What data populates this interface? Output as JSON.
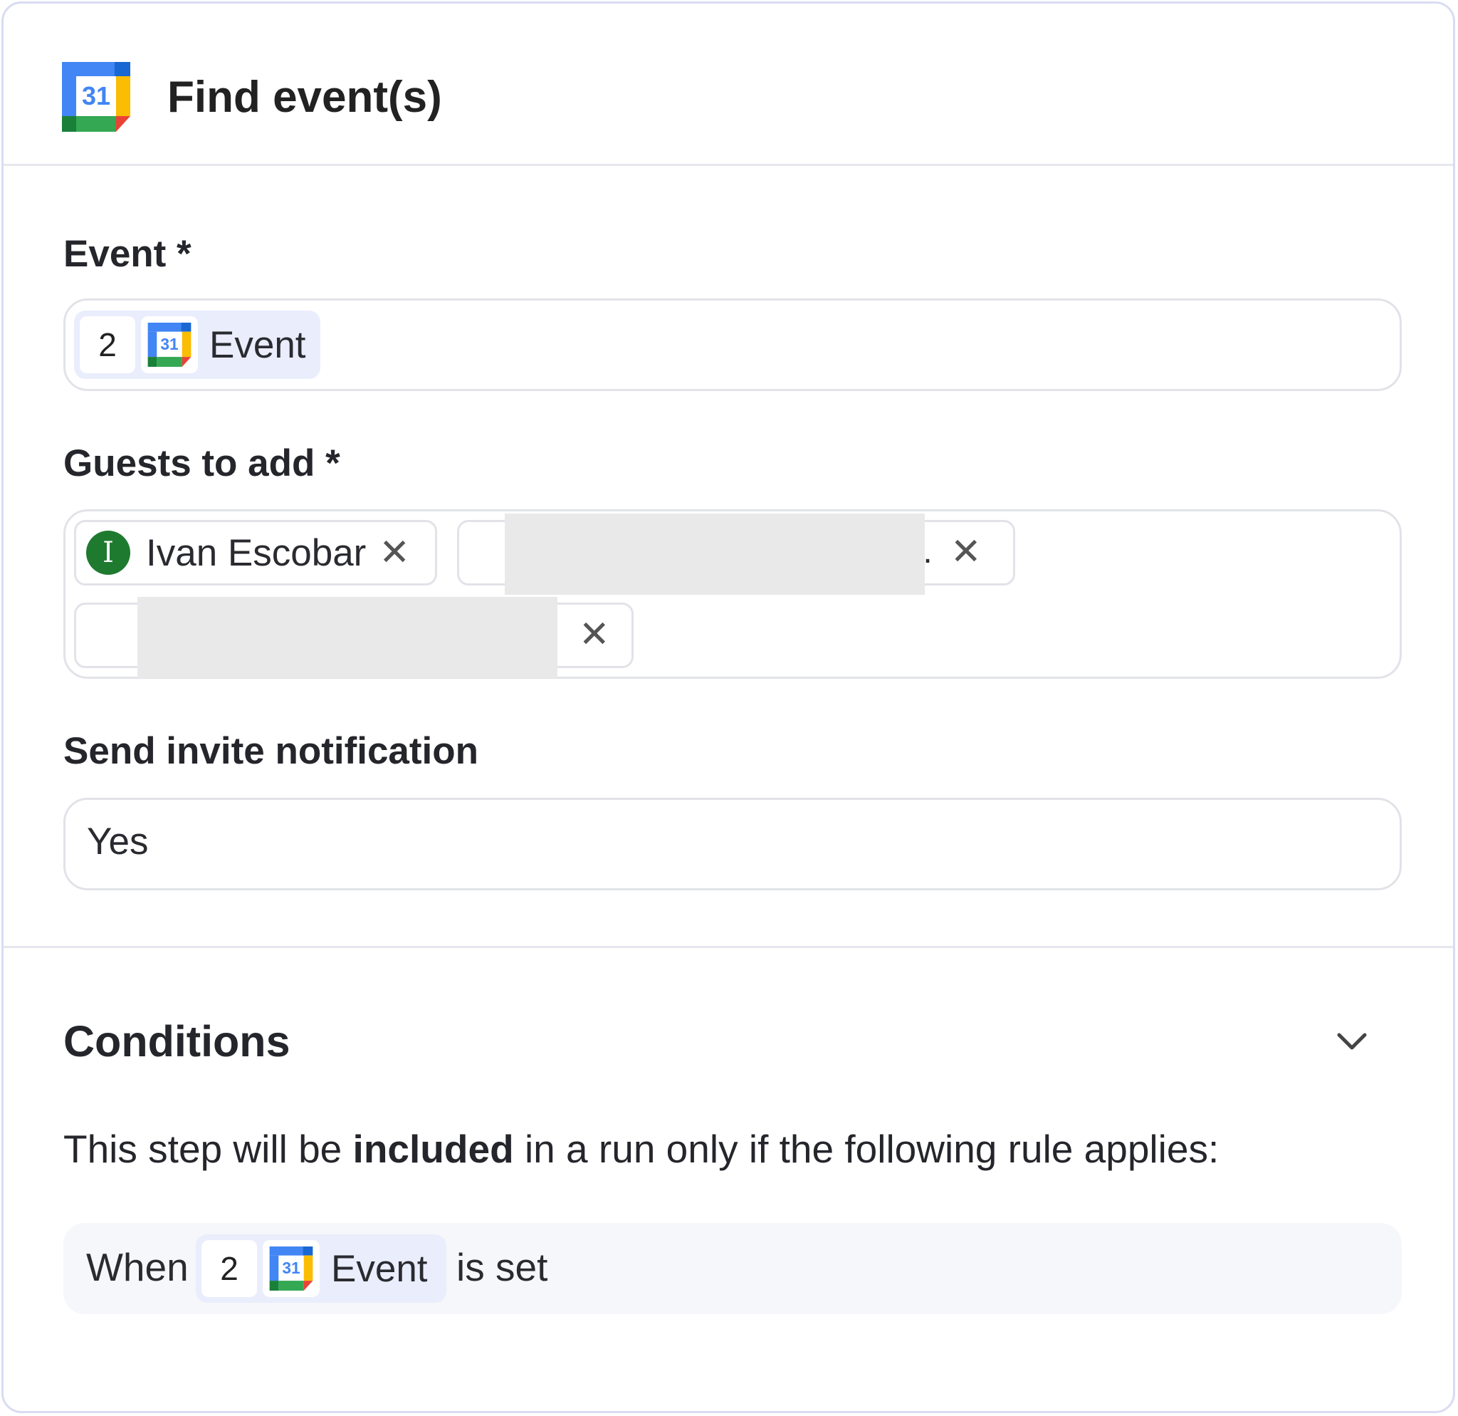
{
  "header": {
    "title": "Find event(s)",
    "app_icon": "google-calendar-icon",
    "icon_day": "31"
  },
  "event_field": {
    "label": "Event *",
    "token": {
      "step": "2",
      "icon": "google-calendar-icon",
      "icon_day": "31",
      "label": "Event"
    }
  },
  "guests_field": {
    "label": "Guests to add *",
    "chips": [
      {
        "avatar_letter": "I",
        "name": "Ivan Escobar",
        "close": "✕"
      },
      {
        "trailing": "..",
        "close": "✕"
      },
      {
        "trailing": ".",
        "close": "✕"
      }
    ]
  },
  "notification_field": {
    "label": "Send invite notification",
    "value": "Yes"
  },
  "conditions": {
    "title": "Conditions",
    "expanded": true,
    "rule_prefix": "This step will be ",
    "rule_bold": "included",
    "rule_suffix": " in a run only if the following rule applies:",
    "rule": {
      "when": "When",
      "token": {
        "step": "2",
        "icon": "google-calendar-icon",
        "icon_day": "31",
        "label": "Event"
      },
      "operator": "is set"
    }
  },
  "colors": {
    "accent_pill": "#eaedfc",
    "avatar": "#1e7a2f",
    "card_border": "#d9dcf2"
  }
}
